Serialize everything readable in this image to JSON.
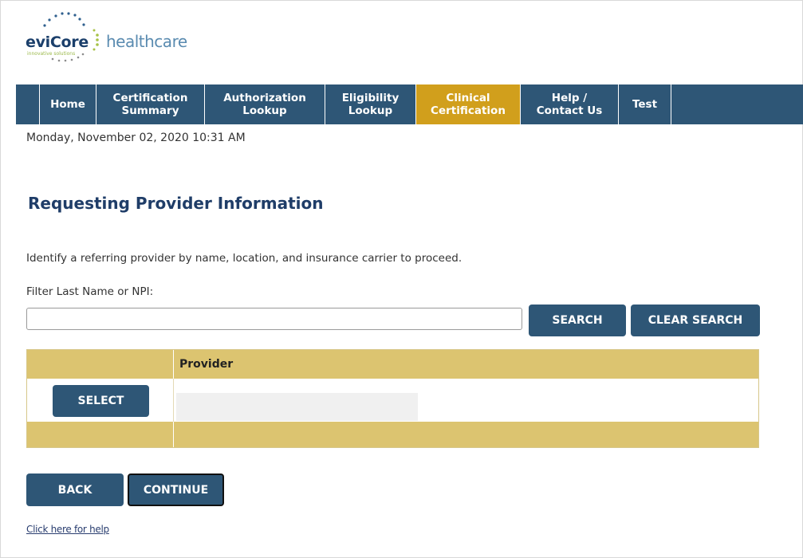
{
  "logo": {
    "brand_bold": "eviCore",
    "brand_light": "healthcare",
    "tagline": "innovative solutions"
  },
  "nav": {
    "items": [
      {
        "label": "Home"
      },
      {
        "label": "Certification\nSummary"
      },
      {
        "label": "Authorization\nLookup"
      },
      {
        "label": "Eligibility\nLookup"
      },
      {
        "label": "Clinical\nCertification",
        "active": true
      },
      {
        "label": "Help /\nContact Us"
      },
      {
        "label": "Test"
      }
    ]
  },
  "datetime": "Monday, November 02, 2020 10:31 AM",
  "page_title": "Requesting Provider Information",
  "instructions": "Identify a referring provider by name, location, and insurance carrier to proceed.",
  "filter": {
    "label": "Filter Last Name or NPI:",
    "value": "",
    "search_label": "SEARCH",
    "clear_label": "CLEAR SEARCH"
  },
  "table": {
    "header_provider": "Provider",
    "rows": [
      {
        "select_label": "SELECT",
        "provider": ""
      }
    ]
  },
  "actions": {
    "back_label": "BACK",
    "continue_label": "CONTINUE"
  },
  "help_link": "Click here for help",
  "colors": {
    "nav_bg": "#2e5676",
    "nav_active": "#d19f1c",
    "title": "#1f3d68",
    "table_band": "#dcc470",
    "button": "#2e5676"
  }
}
